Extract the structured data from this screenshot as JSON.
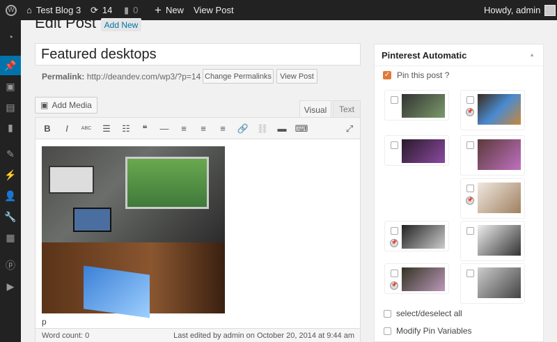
{
  "adminbar": {
    "site": "Test Blog 3",
    "updates": "14",
    "comments": "0",
    "new": "New",
    "view_post": "View Post",
    "howdy": "Howdy, admin"
  },
  "page": {
    "title": "Edit Post",
    "add_new": "Add New"
  },
  "post": {
    "title": "Featured desktops",
    "permalink_label": "Permalink:",
    "permalink_url": "http://deandev.com/wp3/?p=14",
    "change_permalinks": "Change Permalinks",
    "view_post": "View Post"
  },
  "editor": {
    "add_media": "Add Media",
    "tab_visual": "Visual",
    "tab_text": "Text",
    "path": "p",
    "word_count": "Word count: 0",
    "last_edited": "Last edited by admin on October 20, 2014 at 9:44 am",
    "toolbar": [
      {
        "icon": "bold-icon",
        "glyph": "B"
      },
      {
        "icon": "italic-icon",
        "glyph": "I"
      },
      {
        "icon": "strikethrough-icon",
        "glyph": "ABC"
      },
      {
        "icon": "bullet-list-icon",
        "glyph": "☰"
      },
      {
        "icon": "numbered-list-icon",
        "glyph": "☷"
      },
      {
        "icon": "blockquote-icon",
        "glyph": "❝"
      },
      {
        "icon": "horizontal-rule-icon",
        "glyph": "—"
      },
      {
        "icon": "align-left-icon",
        "glyph": "≡"
      },
      {
        "icon": "align-center-icon",
        "glyph": "≡"
      },
      {
        "icon": "align-right-icon",
        "glyph": "≡"
      },
      {
        "icon": "link-icon",
        "glyph": "🔗"
      },
      {
        "icon": "unlink-icon",
        "glyph": "⛓"
      },
      {
        "icon": "read-more-icon",
        "glyph": "▬"
      },
      {
        "icon": "toolbar-toggle-icon",
        "glyph": "⌨"
      }
    ]
  },
  "pinterest": {
    "title": "Pinterest Automatic",
    "pin_this_post": "Pin this post ?",
    "pin_checked": true,
    "select_all": "select/deselect all",
    "modify_vars": "Modify Pin Variables",
    "thumbs": [
      {
        "col": 0,
        "row": 0,
        "pinned": false
      },
      {
        "col": 1,
        "row": 0,
        "pinned": true
      },
      {
        "col": 0,
        "row": 1,
        "pinned": false
      },
      {
        "col": 1,
        "row": 1,
        "pinned": false
      },
      {
        "col": 1,
        "row": 2,
        "pinned": true
      },
      {
        "col": 0,
        "row": 3,
        "pinned": true
      },
      {
        "col": 1,
        "row": 3,
        "pinned": false
      },
      {
        "col": 0,
        "row": 4,
        "pinned": true
      },
      {
        "col": 1,
        "row": 4,
        "pinned": false
      }
    ]
  },
  "colors": {
    "accent": "#0073aa",
    "checkbox": "#e07a3a",
    "bar": "#222222"
  }
}
